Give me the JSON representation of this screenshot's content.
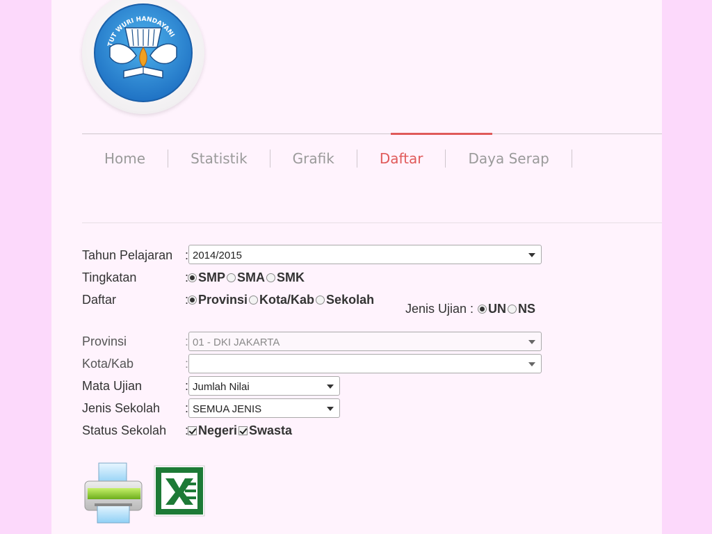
{
  "logo": {
    "text": "TUT WURI HANDAYANI"
  },
  "nav": {
    "items": [
      {
        "label": "Home"
      },
      {
        "label": "Statistik"
      },
      {
        "label": "Grafik"
      },
      {
        "label": "Daftar",
        "active": true
      },
      {
        "label": "Daya Serap"
      }
    ],
    "active_color": "#e05a5a"
  },
  "form": {
    "tahun_pelajaran": {
      "label": "Tahun Pelajaran",
      "value": "2014/2015"
    },
    "tingkatan": {
      "label": "Tingkatan",
      "options": [
        "SMP",
        "SMA",
        "SMK"
      ],
      "selected": "SMP"
    },
    "daftar": {
      "label": "Daftar",
      "options": [
        "Provinsi",
        "Kota/Kab",
        "Sekolah"
      ],
      "selected": "Provinsi"
    },
    "jenis_ujian": {
      "label": "Jenis Ujian :",
      "options": [
        "UN",
        "NS"
      ],
      "selected": "UN"
    },
    "provinsi": {
      "label": "Provinsi",
      "value": "01 - DKI JAKARTA"
    },
    "kota_kab": {
      "label": "Kota/Kab",
      "value": ""
    },
    "mata_ujian": {
      "label": "Mata Ujian",
      "value": "Jumlah Nilai"
    },
    "jenis_sekolah": {
      "label": "Jenis Sekolah",
      "value": "SEMUA JENIS"
    },
    "status_sekolah": {
      "label": "Status Sekolah",
      "options": [
        "Negeri",
        "Swasta"
      ],
      "checked": [
        "Negeri",
        "Swasta"
      ]
    },
    "colon": ":"
  },
  "tools": {
    "print_icon": "printer-icon",
    "excel_icon": "excel-icon"
  },
  "colors": {
    "side_background": "#fcd9fb",
    "page_background": "#fff3fd"
  }
}
